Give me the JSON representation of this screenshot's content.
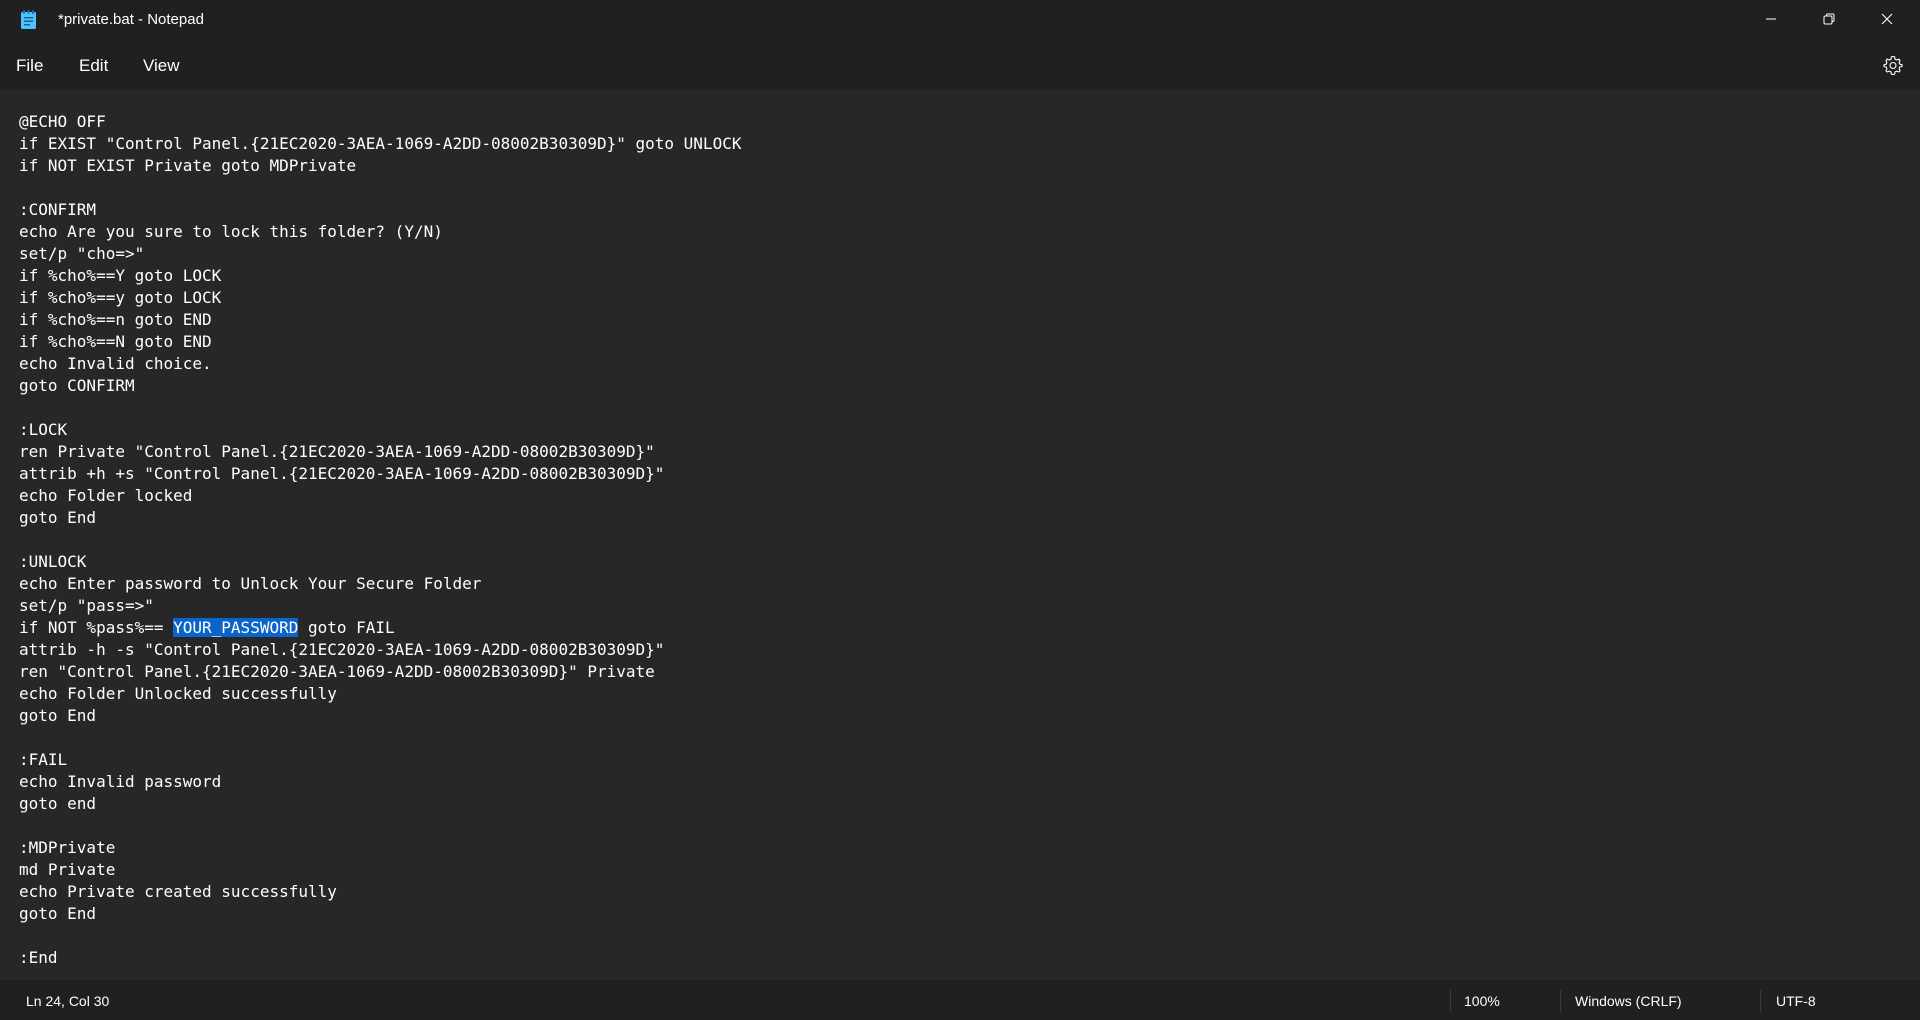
{
  "window": {
    "title": "*private.bat - Notepad",
    "minimize_icon": "minimize-icon",
    "maximize_icon": "restore-icon",
    "close_icon": "close-icon"
  },
  "menu": {
    "file": "File",
    "edit": "Edit",
    "view": "View",
    "settings_icon": "gear-icon"
  },
  "editor": {
    "lines": [
      "@ECHO OFF",
      "if EXIST \"Control Panel.{21EC2020-3AEA-1069-A2DD-08002B30309D}\" goto UNLOCK",
      "if NOT EXIST Private goto MDPrivate",
      "",
      ":CONFIRM",
      "echo Are you sure to lock this folder? (Y/N)",
      "set/p \"cho=>\"",
      "if %cho%==Y goto LOCK",
      "if %cho%==y goto LOCK",
      "if %cho%==n goto END",
      "if %cho%==N goto END",
      "echo Invalid choice.",
      "goto CONFIRM",
      "",
      ":LOCK",
      "ren Private \"Control Panel.{21EC2020-3AEA-1069-A2DD-08002B30309D}\"",
      "attrib +h +s \"Control Panel.{21EC2020-3AEA-1069-A2DD-08002B30309D}\"",
      "echo Folder locked",
      "goto End",
      "",
      ":UNLOCK",
      "echo Enter password to Unlock Your Secure Folder",
      "set/p \"pass=>\"",
      "if NOT %pass%== YOUR_PASSWORD goto FAIL",
      "attrib -h -s \"Control Panel.{21EC2020-3AEA-1069-A2DD-08002B30309D}\"",
      "ren \"Control Panel.{21EC2020-3AEA-1069-A2DD-08002B30309D}\" Private",
      "echo Folder Unlocked successfully",
      "goto End",
      "",
      ":FAIL",
      "echo Invalid password",
      "goto end",
      "",
      ":MDPrivate",
      "md Private",
      "echo Private created successfully",
      "goto End",
      "",
      ":End"
    ],
    "selection": {
      "line_index": 23,
      "before": "if NOT %pass%== ",
      "selected": "YOUR_PASSWORD",
      "after": " goto FAIL"
    }
  },
  "status": {
    "cursor": "Ln 24, Col 30",
    "zoom": "100%",
    "line_ending": "Windows (CRLF)",
    "encoding": "UTF-8"
  },
  "colors": {
    "editor_bg": "#272727",
    "chrome_bg": "#202020",
    "selection": "#0a64c9",
    "text": "#ffffff"
  }
}
